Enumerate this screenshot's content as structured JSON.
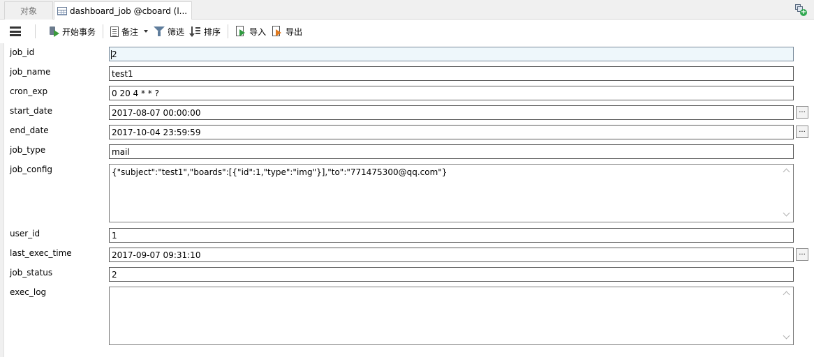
{
  "tabs": {
    "objects_label": "对象",
    "active_label": "dashboard_job @cboard (l..."
  },
  "toolbar": {
    "begin_transaction": "开始事务",
    "memo": "备注",
    "filter": "筛选",
    "sort": "排序",
    "import": "导入",
    "export": "导出"
  },
  "fields": {
    "job_id": {
      "label": "job_id",
      "value": "2"
    },
    "job_name": {
      "label": "job_name",
      "value": "test1"
    },
    "cron_exp": {
      "label": "cron_exp",
      "value": "0 20 4 * * ?"
    },
    "start_date": {
      "label": "start_date",
      "value": "2017-08-07 00:00:00"
    },
    "end_date": {
      "label": "end_date",
      "value": "2017-10-04 23:59:59"
    },
    "job_type": {
      "label": "job_type",
      "value": "mail"
    },
    "job_config": {
      "label": "job_config",
      "value": "{\"subject\":\"test1\",\"boards\":[{\"id\":1,\"type\":\"img\"}],\"to\":\"771475300@qq.com\"}"
    },
    "user_id": {
      "label": "user_id",
      "value": "1"
    },
    "last_exec_time": {
      "label": "last_exec_time",
      "value": "2017-09-07 09:31:10"
    },
    "job_status": {
      "label": "job_status",
      "value": "2"
    },
    "exec_log": {
      "label": "exec_log",
      "value": ""
    }
  },
  "ellipsis_label": "..."
}
